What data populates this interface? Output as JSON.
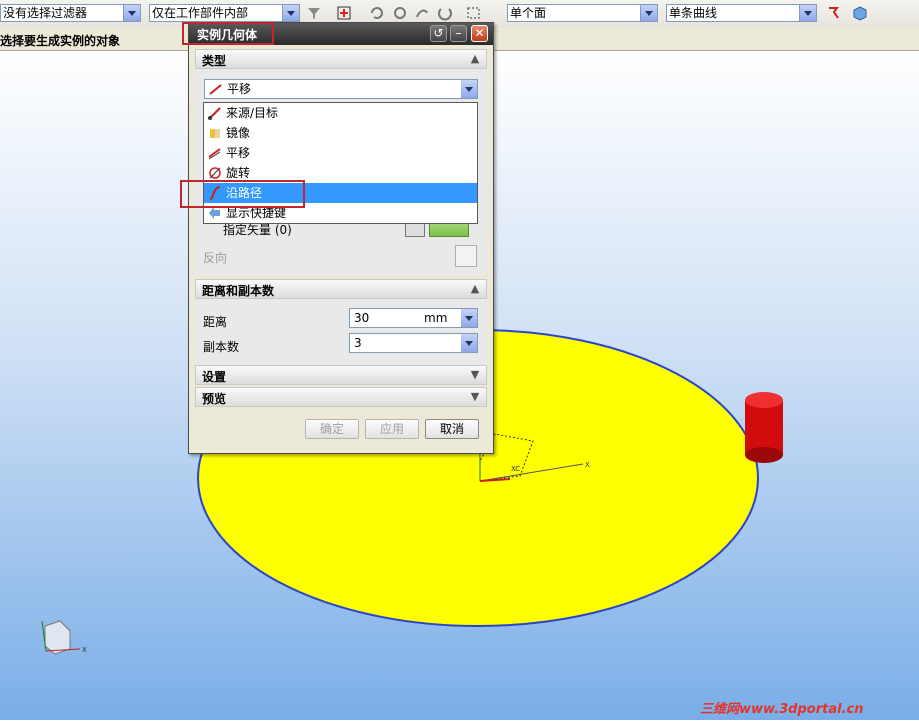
{
  "toolbar": {
    "filter_combo": "没有选择过滤器",
    "scope_combo": "仅在工作部件内部",
    "face_combo": "单个面",
    "curve_combo": "单条曲线"
  },
  "status": {
    "prompt": "选择要生成实例的对象"
  },
  "dialog": {
    "title": "实例几何体",
    "sections": {
      "type": "类型",
      "distance_count": "距离和副本数",
      "settings": "设置",
      "preview": "预览"
    },
    "type_value": "平移",
    "type_options": [
      "来源/目标",
      "镜像",
      "平移",
      "旋转",
      "沿路径",
      "显示快捷键"
    ],
    "selected_option_index": 4,
    "specify_vector_label": "指定矢量 (0)",
    "reverse_label": "反向",
    "distance_label": "距离",
    "distance_value": "30",
    "distance_unit": "mm",
    "count_label": "副本数",
    "count_value": "3",
    "buttons": {
      "ok": "确定",
      "apply": "应用",
      "cancel": "取消"
    }
  },
  "viewport": {
    "wcs_x": "X",
    "wcs_xc": "XC",
    "triad_x": "X"
  },
  "watermark": "三维网www.3dportal.cn",
  "colors": {
    "disk": "#ffff00",
    "cylinder": "#e01010",
    "selection": "#3399ff",
    "highlight_box": "#c0262b"
  }
}
